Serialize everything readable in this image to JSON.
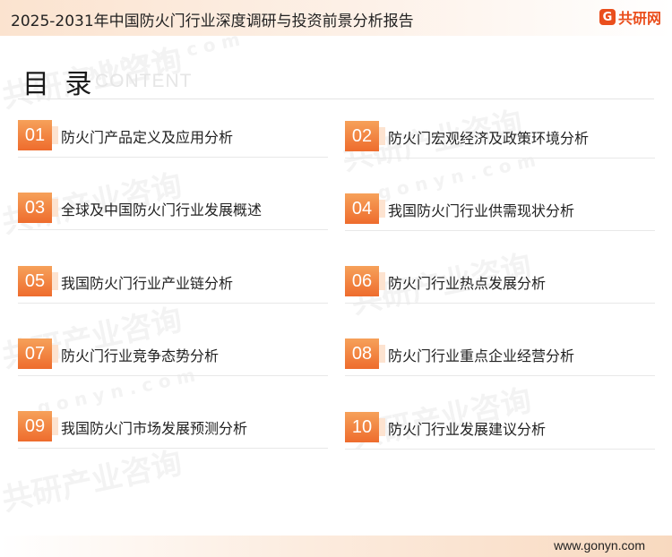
{
  "header": {
    "report_title": "2025-2031年中国防火门行业深度调研与投资前景分析报告",
    "brand_mark": "G",
    "brand_name": "共研网"
  },
  "heading": {
    "title": "目 录",
    "subtitle": "CONTENT"
  },
  "toc": [
    {
      "num": "01",
      "label": "防火门产品定义及应用分析"
    },
    {
      "num": "02",
      "label": "防火门宏观经济及政策环境分析"
    },
    {
      "num": "03",
      "label": "全球及中国防火门行业发展概述"
    },
    {
      "num": "04",
      "label": "我国防火门行业供需现状分析"
    },
    {
      "num": "05",
      "label": "我国防火门行业产业链分析"
    },
    {
      "num": "06",
      "label": "防火门行业热点发展分析"
    },
    {
      "num": "07",
      "label": "防火门行业竞争态势分析"
    },
    {
      "num": "08",
      "label": "防火门行业重点企业经营分析"
    },
    {
      "num": "09",
      "label": "我国防火门市场发展预测分析"
    },
    {
      "num": "10",
      "label": "防火门行业发展建议分析"
    }
  ],
  "watermark": {
    "cn": "共研产业咨询",
    "url": "g o n y n . c o m"
  },
  "footer": {
    "url": "www.gonyn.com"
  },
  "colors": {
    "accent": "#ee6c2d",
    "brand": "#ea4e1c"
  }
}
